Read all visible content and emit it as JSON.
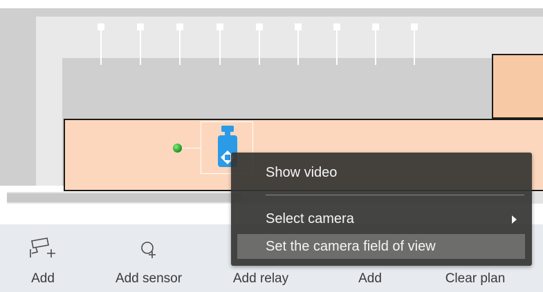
{
  "toolbar": {
    "items": [
      {
        "label": "Add",
        "icon": "add-camera-icon"
      },
      {
        "label": "Add sensor",
        "icon": "add-sensor-icon"
      },
      {
        "label": "Add relay",
        "icon": "add-relay-icon"
      },
      {
        "label": "Add",
        "icon": "add-object-icon"
      },
      {
        "label": "Clear plan",
        "icon": "clear-plan-icon"
      }
    ]
  },
  "context_menu": {
    "items": [
      {
        "label": "Show video"
      },
      {
        "label": "Select camera",
        "has_submenu": true
      },
      {
        "label": "Set the camera field of view",
        "highlighted": true
      }
    ]
  },
  "colors": {
    "room_fill": "#fcd7bd",
    "room_right_fill": "#f8c9a5",
    "camera_accent": "#2b9be8",
    "sensor_green": "#2aa52f",
    "menu_bg": "#343432",
    "menu_highlight": "#6d6d6b",
    "toolbar_bg": "#e7eaef"
  }
}
